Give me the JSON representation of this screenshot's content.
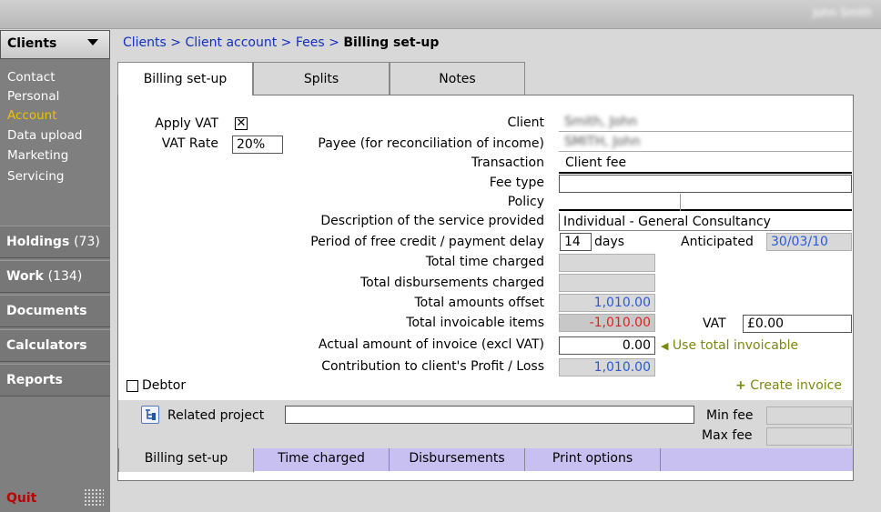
{
  "user": {
    "name": "John Smith"
  },
  "sidebar": {
    "header": "Clients",
    "subitems": [
      "Contact",
      "Personal",
      "Account",
      "Data upload",
      "Marketing",
      "Servicing"
    ],
    "nav": [
      {
        "label": "Holdings",
        "count": "(73)"
      },
      {
        "label": "Work",
        "count": "(134)"
      },
      {
        "label": "Documents",
        "count": ""
      },
      {
        "label": "Calculators",
        "count": ""
      },
      {
        "label": "Reports",
        "count": ""
      }
    ],
    "quit": "Quit"
  },
  "breadcrumb": {
    "items": [
      "Clients",
      "Client account",
      "Fees"
    ],
    "sep": " > ",
    "current": "Billing set-up"
  },
  "tabs": [
    "Billing set-up",
    "Splits",
    "Notes"
  ],
  "form": {
    "apply_vat_label": "Apply VAT",
    "apply_vat_mark": "✕",
    "vat_rate_label": "VAT Rate",
    "vat_rate_value": "20%",
    "client_label": "Client",
    "client_value": "Smith, John",
    "payee_label": "Payee (for reconciliation of income)",
    "payee_value": "SMITH, John",
    "transaction_label": "Transaction",
    "transaction_value": "Client fee",
    "fee_type_label": "Fee type",
    "fee_type_value": "",
    "policy_label": "Policy",
    "description_label": "Description of the service provided",
    "description_value": "Individual - General Consultancy",
    "credit_label": "Period of free credit / payment delay",
    "credit_value": "14",
    "credit_unit": "days",
    "anticipated_label": "Anticipated",
    "anticipated_value": "30/03/10",
    "time_label": "Total time charged",
    "time_value": "",
    "disb_label": "Total disbursements charged",
    "disb_value": "",
    "offset_label": "Total amounts offset",
    "offset_value": "1,010.00",
    "invoicable_label": "Total invoicable items",
    "invoicable_value": "-1,010.00",
    "vat_label": "VAT",
    "vat_value": "£0.00",
    "actual_label": "Actual amount of invoice (excl VAT)",
    "actual_value": "0.00",
    "use_total": "Use total invoicable",
    "contribution_label": "Contribution to client's Profit / Loss",
    "contribution_value": "1,010.00",
    "debtor_label": "Debtor",
    "create_invoice": "Create invoice",
    "related_label": "Related project",
    "related_value": "",
    "min_fee_label": "Min fee",
    "max_fee_label": "Max fee"
  },
  "bottom_tabs": [
    "Billing set-up",
    "Time charged",
    "Disbursements",
    "Print options"
  ],
  "colors": {
    "link": "#1030c0",
    "accent": "#f0c000",
    "quit": "#c00000",
    "strip": "#c8c0f0"
  }
}
